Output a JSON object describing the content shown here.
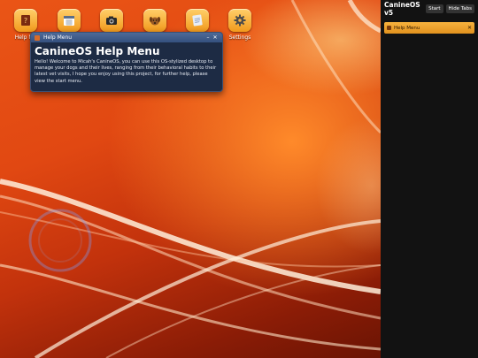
{
  "desktop": {
    "icons": [
      {
        "label": "Help Me",
        "icon": "help-book-icon"
      },
      {
        "label": "",
        "icon": "calendar-icon"
      },
      {
        "label": "",
        "icon": "camera-icon"
      },
      {
        "label": "",
        "icon": "dog-icon"
      },
      {
        "label": "",
        "icon": "notepad-icon"
      },
      {
        "label": "Settings",
        "icon": "gear-icon"
      }
    ]
  },
  "help_window": {
    "title": "Help Menu",
    "minimize": "–",
    "close": "✕",
    "heading": "CanineOS Help Menu",
    "body": "Hello! Welcome to Micah's CanineOS, you can use this OS-stylized desktop to manage your dogs and their lives, ranging from their behavioral habits to their latest vet visits, I hope you enjoy using this project, for further help, please view the start menu."
  },
  "sidebar": {
    "title": "CanineOS v5",
    "start_label": "Start",
    "hide_tabs_label": "Hide Tabs",
    "tasks": [
      {
        "label": "Help Menu",
        "close": "✕"
      }
    ]
  },
  "colors": {
    "accent": "#f29a1c",
    "window_bg": "#1d2b44",
    "sidebar_bg": "#121212"
  }
}
